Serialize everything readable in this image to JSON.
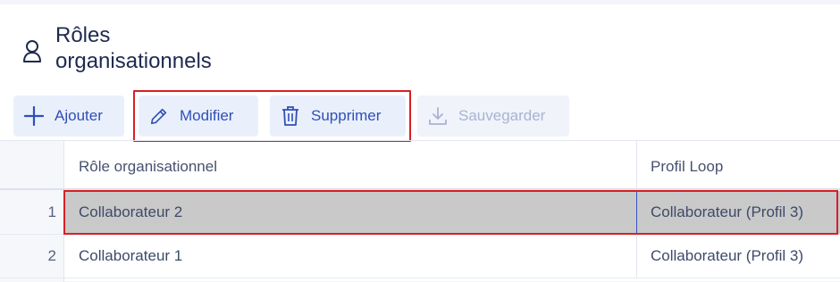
{
  "header": {
    "title": "Rôles\norganisationnels",
    "icon": "user-icon"
  },
  "toolbar": {
    "add_label": "Ajouter",
    "edit_label": "Modifier",
    "delete_label": "Supprimer",
    "save_label": "Sauvegarder",
    "save_disabled": true
  },
  "grid": {
    "columns": [
      "Rôle organisationnel",
      "Profil Loop"
    ],
    "rows": [
      {
        "index": "1",
        "role": "Collaborateur 2",
        "profile": "Collaborateur (Profil 3)",
        "selected": true
      },
      {
        "index": "2",
        "role": "Collaborateur 1",
        "profile": "Collaborateur (Profil 3)",
        "selected": false
      }
    ]
  },
  "colors": {
    "accent": "#2f4fb8",
    "highlight": "#d81f26",
    "selected_row": "#c9c9c9"
  }
}
